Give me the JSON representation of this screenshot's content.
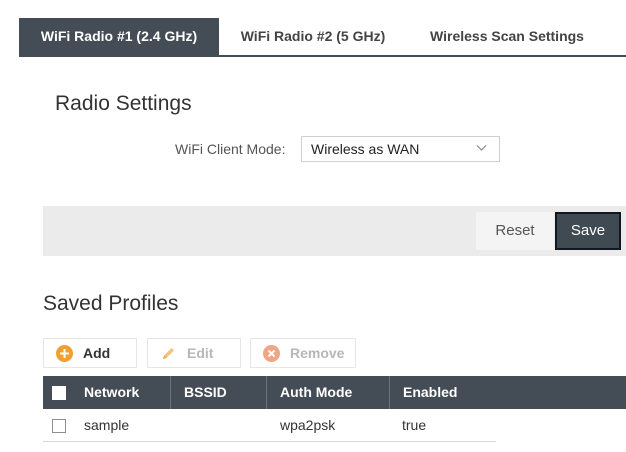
{
  "tabs": [
    {
      "label": "WiFi Radio #1 (2.4 GHz)",
      "active": true
    },
    {
      "label": "WiFi Radio #2 (5 GHz)",
      "active": false
    },
    {
      "label": "Wireless Scan Settings",
      "active": false
    }
  ],
  "radio_settings": {
    "title": "Radio Settings",
    "client_mode_label": "WiFi Client Mode:",
    "client_mode_value": "Wireless as WAN"
  },
  "actions": {
    "reset_label": "Reset",
    "save_label": "Save"
  },
  "saved_profiles": {
    "title": "Saved Profiles",
    "toolbar": {
      "add_label": "Add",
      "edit_label": "Edit",
      "remove_label": "Remove"
    },
    "columns": [
      "Network",
      "BSSID",
      "Auth Mode",
      "Enabled"
    ],
    "rows": [
      {
        "network": "sample",
        "bssid": "",
        "auth_mode": "wpa2psk",
        "enabled": "true"
      }
    ]
  },
  "colors": {
    "header_dark": "#444d55",
    "add_icon": "#f0a030",
    "remove_icon": "#f2a584",
    "edit_icon": "#f2c27e"
  }
}
